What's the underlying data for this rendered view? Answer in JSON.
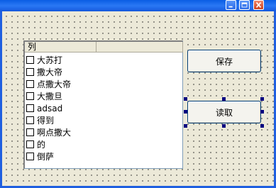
{
  "window": {
    "controls": [
      "minimize-icon",
      "maximize-icon",
      "close-icon"
    ],
    "accent": "#0a5de4"
  },
  "listview": {
    "columns": [
      "列",
      ""
    ],
    "items": [
      {
        "label": "大苏打",
        "checked": false
      },
      {
        "label": "撒大帝",
        "checked": false
      },
      {
        "label": "点撒大帝",
        "checked": false
      },
      {
        "label": "大撒旦",
        "checked": false
      },
      {
        "label": "adsad",
        "checked": false
      },
      {
        "label": "得到",
        "checked": false
      },
      {
        "label": "啊点撒大",
        "checked": false
      },
      {
        "label": "的",
        "checked": false
      },
      {
        "label": "倒萨",
        "checked": false
      }
    ]
  },
  "buttons": {
    "save_label": "保存",
    "load_label": "读取"
  }
}
